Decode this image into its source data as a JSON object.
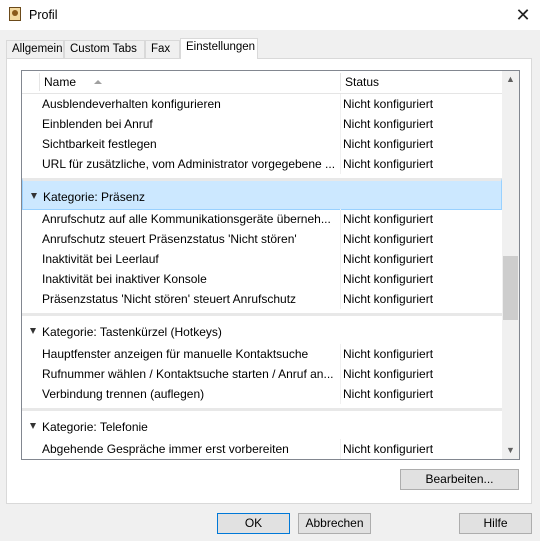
{
  "window": {
    "title": "Profil",
    "close_glyph": "✕",
    "icon": "app-profile-icon"
  },
  "tabs": [
    {
      "label": "Allgemein"
    },
    {
      "label": "Custom Tabs"
    },
    {
      "label": "Fax"
    },
    {
      "label": "Einstellungen"
    }
  ],
  "active_tab": "Einstellungen",
  "list": {
    "columns": {
      "name": "Name",
      "status": "Status"
    },
    "sort": {
      "column": "Name",
      "direction": "ascending"
    },
    "rows": [
      {
        "name": "Ausblendeverhalten konfigurieren",
        "status": "Nicht konfiguriert"
      },
      {
        "name": "Einblenden bei Anruf",
        "status": "Nicht konfiguriert"
      },
      {
        "name": "Sichtbarkeit festlegen",
        "status": "Nicht konfiguriert"
      },
      {
        "name": "URL für zusätzliche, vom Administrator vorgegebene ...",
        "status": "Nicht konfiguriert"
      },
      {
        "category": "Kategorie: Präsenz",
        "selected": true
      },
      {
        "name": "Anrufschutz auf alle Kommunikationsgeräte überneh...",
        "status": "Nicht konfiguriert"
      },
      {
        "name": "Anrufschutz steuert Präsenzstatus 'Nicht stören'",
        "status": "Nicht konfiguriert"
      },
      {
        "name": "Inaktivität bei Leerlauf",
        "status": "Nicht konfiguriert"
      },
      {
        "name": "Inaktivität bei inaktiver Konsole",
        "status": "Nicht konfiguriert"
      },
      {
        "name": "Präsenzstatus 'Nicht stören' steuert Anrufschutz",
        "status": "Nicht konfiguriert"
      },
      {
        "category": "Kategorie: Tastenkürzel (Hotkeys)"
      },
      {
        "name": "Hauptfenster anzeigen für manuelle Kontaktsuche",
        "status": "Nicht konfiguriert"
      },
      {
        "name": "Rufnummer wählen / Kontaktsuche starten / Anruf an...",
        "status": "Nicht konfiguriert"
      },
      {
        "name": "Verbindung trennen (auflegen)",
        "status": "Nicht konfiguriert"
      },
      {
        "category": "Kategorie: Telefonie"
      },
      {
        "name": "Abgehende Gespräche immer erst vorbereiten",
        "status": "Nicht konfiguriert"
      }
    ],
    "scrollbar": {
      "up_glyph": "▲",
      "down_glyph": "▼"
    }
  },
  "buttons": {
    "edit": "Bearbeiten...",
    "ok": "OK",
    "cancel": "Abbrechen",
    "help": "Hilfe"
  },
  "colors": {
    "selection_fill": "#cce8ff",
    "selection_border": "#99d1ff",
    "default_button_border": "#0078d7"
  }
}
